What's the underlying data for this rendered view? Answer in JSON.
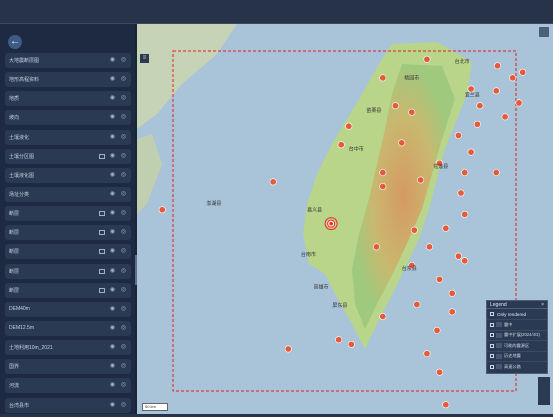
{
  "sidebar": {
    "layers": [
      {
        "label": "大地震断层图",
        "extra_icon": false
      },
      {
        "label": "地形高程资料",
        "extra_icon": false
      },
      {
        "label": "地质",
        "extra_icon": false
      },
      {
        "label": "坡向",
        "extra_icon": false
      },
      {
        "label": "土壤液化",
        "extra_icon": false
      },
      {
        "label": "土壤分区图",
        "extra_icon": true
      },
      {
        "label": "土壤液化图",
        "extra_icon": false
      },
      {
        "label": "场址分类",
        "extra_icon": false
      },
      {
        "label": "断层",
        "extra_icon": true
      },
      {
        "label": "断层",
        "extra_icon": true
      },
      {
        "label": "断层",
        "extra_icon": true
      },
      {
        "label": "断层",
        "extra_icon": true
      },
      {
        "label": "断层",
        "extra_icon": true
      },
      {
        "label": "DEM40m",
        "extra_icon": false
      },
      {
        "label": "DEM12.5m",
        "extra_icon": false
      },
      {
        "label": "土地利用10m_2021",
        "extra_icon": false
      },
      {
        "label": "国界",
        "extra_icon": false
      },
      {
        "label": "河流",
        "extra_icon": false
      },
      {
        "label": "台湾县市",
        "extra_icon": false
      }
    ]
  },
  "map": {
    "place_labels": [
      "台北市",
      "苗栗县",
      "台中市",
      "嘉义县",
      "台南市",
      "高雄市",
      "花莲县",
      "台东县",
      "屏东县",
      "澎湖县",
      "宜兰县",
      "桃园市"
    ],
    "epicenter": {
      "lon": 120.54,
      "lat": 23.35
    },
    "markers": [
      {
        "lon": 121.86,
        "lat": 25.05
      },
      {
        "lon": 121.98,
        "lat": 24.92
      },
      {
        "lon": 122.06,
        "lat": 24.98
      },
      {
        "lon": 121.85,
        "lat": 24.78
      },
      {
        "lon": 122.03,
        "lat": 24.65
      },
      {
        "lon": 121.72,
        "lat": 24.62
      },
      {
        "lon": 121.92,
        "lat": 24.5
      },
      {
        "lon": 121.7,
        "lat": 24.42
      },
      {
        "lon": 121.55,
        "lat": 24.3
      },
      {
        "lon": 121.65,
        "lat": 24.12
      },
      {
        "lon": 121.4,
        "lat": 24.0
      },
      {
        "lon": 121.6,
        "lat": 23.9
      },
      {
        "lon": 121.25,
        "lat": 23.82
      },
      {
        "lon": 121.57,
        "lat": 23.68
      },
      {
        "lon": 121.6,
        "lat": 23.45
      },
      {
        "lon": 121.45,
        "lat": 23.3
      },
      {
        "lon": 121.32,
        "lat": 23.1
      },
      {
        "lon": 121.55,
        "lat": 23.0
      },
      {
        "lon": 121.18,
        "lat": 22.9
      },
      {
        "lon": 121.4,
        "lat": 22.75
      },
      {
        "lon": 121.5,
        "lat": 22.6
      },
      {
        "lon": 121.22,
        "lat": 22.48
      },
      {
        "lon": 121.5,
        "lat": 22.4
      },
      {
        "lon": 121.38,
        "lat": 22.2
      },
      {
        "lon": 120.7,
        "lat": 22.05
      },
      {
        "lon": 121.3,
        "lat": 21.95
      },
      {
        "lon": 121.4,
        "lat": 21.75
      },
      {
        "lon": 120.95,
        "lat": 23.75
      },
      {
        "lon": 120.95,
        "lat": 23.9
      },
      {
        "lon": 120.62,
        "lat": 24.2
      },
      {
        "lon": 120.68,
        "lat": 24.4
      },
      {
        "lon": 121.1,
        "lat": 24.22
      },
      {
        "lon": 121.05,
        "lat": 24.62
      },
      {
        "lon": 121.3,
        "lat": 25.12
      },
      {
        "lon": 120.95,
        "lat": 24.92
      },
      {
        "lon": 121.2,
        "lat": 23.28
      },
      {
        "lon": 120.9,
        "lat": 23.1
      },
      {
        "lon": 120.6,
        "lat": 22.1
      },
      {
        "lon": 120.2,
        "lat": 22.0
      },
      {
        "lon": 119.2,
        "lat": 23.5
      },
      {
        "lon": 120.08,
        "lat": 23.8
      },
      {
        "lon": 121.85,
        "lat": 23.9
      },
      {
        "lon": 121.6,
        "lat": 22.95
      },
      {
        "lon": 121.45,
        "lat": 21.4
      },
      {
        "lon": 120.95,
        "lat": 22.35
      },
      {
        "lon": 121.65,
        "lat": 24.8
      },
      {
        "lon": 121.18,
        "lat": 24.55
      }
    ],
    "scale_label": "50 km"
  },
  "legend": {
    "title": "Legend",
    "close": "×",
    "only_rendered": "Only rendered",
    "items": [
      "震中",
      "震中扩展(2024/4/3)",
      "可能的震源区",
      "历史地震",
      "高速公路"
    ]
  },
  "colors": {
    "marker": "#e45a3a",
    "epicenter": "#ff2222",
    "boundary": "#e02020",
    "coast_lowland": "#b8d58a",
    "mountain": "#cc8a50"
  }
}
